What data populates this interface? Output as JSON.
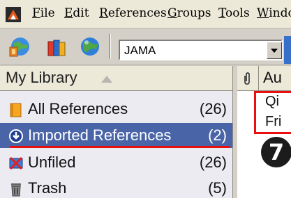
{
  "menubar": {
    "items": [
      {
        "underline": "F",
        "rest": "ile"
      },
      {
        "underline": "E",
        "rest": "dit"
      },
      {
        "underline": "R",
        "rest": "eferences"
      },
      {
        "underline": "G",
        "rest": "roups"
      },
      {
        "underline": "T",
        "rest": "ools"
      },
      {
        "underline": "W",
        "rest": "indo"
      }
    ]
  },
  "toolbar": {
    "style_value": "JAMA",
    "icons": [
      "online-search-mode-icon",
      "local-library-mode-icon",
      "integrated-library-mode-icon"
    ]
  },
  "library": {
    "header": "My Library",
    "sort_indicator": "▲",
    "items": [
      {
        "label": "All References",
        "count": "(26)",
        "icon": "folder-icon"
      },
      {
        "label": "Imported References",
        "count": "(2)",
        "icon": "import-icon",
        "selected": true
      },
      {
        "label": "Unfiled",
        "count": "(26)",
        "icon": "unfiled-icon"
      },
      {
        "label": "Trash",
        "count": "(5)",
        "icon": "trash-icon"
      }
    ]
  },
  "references": {
    "header_author": "Au",
    "rows": [
      "Qi",
      "Fri"
    ]
  },
  "annotation": {
    "badge_number": "7",
    "highlight_color": "#e81010"
  },
  "colors": {
    "selection": "#4a64a8",
    "list_background": "#ecebf2"
  }
}
